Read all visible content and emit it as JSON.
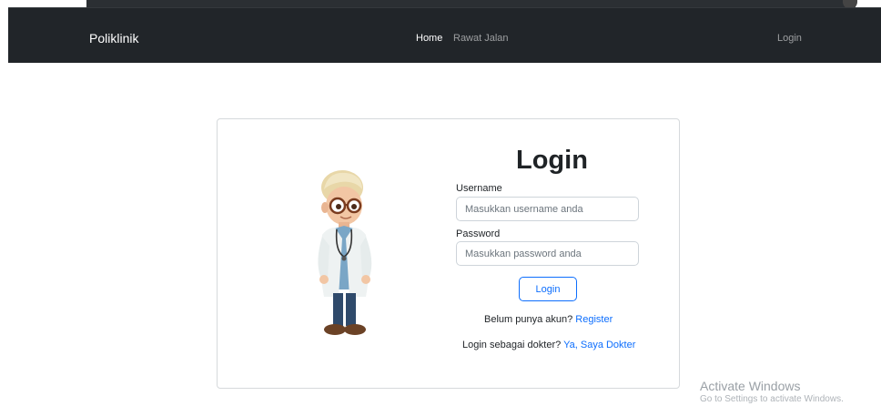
{
  "navbar": {
    "brand": "Poliklinik",
    "items": [
      {
        "label": "Home",
        "active": true
      },
      {
        "label": "Rawat Jalan",
        "active": false
      }
    ],
    "login_label": "Login"
  },
  "login": {
    "title": "Login",
    "username_label": "Username",
    "username_placeholder": "Masukkan username anda",
    "password_label": "Password",
    "password_placeholder": "Masukkan password anda",
    "submit_label": "Login",
    "register_prompt": "Belum punya akun?",
    "register_link": "Register",
    "doctor_prompt": "Login sebagai dokter?",
    "doctor_link": "Ya, Saya Dokter"
  },
  "watermark": {
    "title": "Activate Windows",
    "subtitle": "Go to Settings to activate Windows."
  },
  "colors": {
    "navbar_bg": "#212529",
    "accent": "#0d6efd"
  },
  "icons": [
    "doctor-illustration"
  ]
}
